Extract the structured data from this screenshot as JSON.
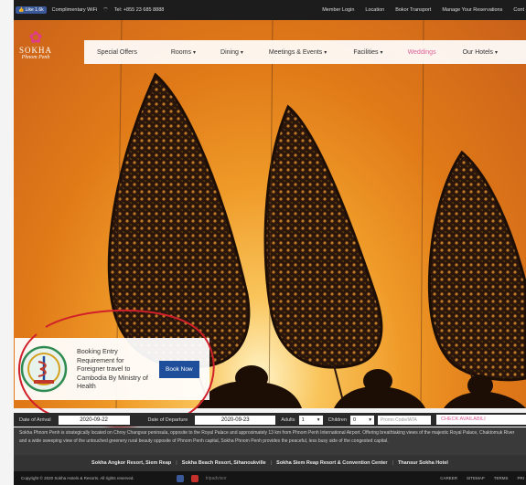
{
  "topbar": {
    "fb_like_label": "👍 Like 1.6k",
    "wifi_label": "Complimentary WiFi",
    "phone": "Tel: +855 23 685 8888",
    "links": [
      "Member Login",
      "Location",
      "Bokor Transport",
      "Manage Your Reservations",
      "Cont"
    ]
  },
  "logo": {
    "name": "SOKHA",
    "sub": "Phnom Penh"
  },
  "nav": {
    "items": [
      {
        "label": "Special Offers",
        "caret": ""
      },
      {
        "label": "Rooms",
        "caret": "▾"
      },
      {
        "label": "Dining",
        "caret": "▾"
      },
      {
        "label": "Meetings & Events",
        "caret": "▾"
      },
      {
        "label": "Facilities",
        "caret": "▾"
      },
      {
        "label": "Weddings",
        "caret": ""
      },
      {
        "label": "Our Hotels",
        "caret": "▾"
      }
    ],
    "active_color": "#e0609a"
  },
  "popup": {
    "text": "Booking Entry Requirement for Foreigner travel to Cambodia By Ministry of Health",
    "button": "Book Now",
    "button_color": "#1f4f9a"
  },
  "booking": {
    "arrival_label": "Date of Arrival",
    "arrival_value": "2020-09-22",
    "departure_label": "Date of Departure",
    "departure_value": "2020-09-23",
    "adults_label": "Adults",
    "adults_value": "1",
    "children_label": "Children",
    "children_value": "0",
    "promo_placeholder": "Promo Code/IATA",
    "check_label": "CHECK AVAILABILI"
  },
  "description": "Sokha Phnom Penh is strategically located on Chroy Changvar peninsula, opposite to the Royal Palace and approximately 13 km from Phnom Penh International Airport. Offering breathtaking views of the majestic Royal Palace, Chaktomuk River and a wide sweeping view of the untouched greenery rural beauty opposite of Phnom Penh capital, Sokha Phnom Penh provides the peaceful, less busy side of the congested capital.",
  "resorts": [
    "Sokha Angkor Resort, Siem Reap",
    "Sokha Beach Resort, Sihanoukville",
    "Sokha Siem Reap Resort & Convention Center",
    "Thansur Sokha Hotel"
  ],
  "footer": {
    "copyright": "Copyright © 2020 Sokha Hotels & Resorts. All rights reserved.",
    "social_extra": "tripadvisor",
    "links": [
      "CAREER",
      "SITEMAP",
      "TERMS",
      "PRI"
    ]
  },
  "colors": {
    "accent_pink": "#e0609a",
    "booking_blue": "#1f4f9a",
    "circle_red": "#d0202a"
  }
}
